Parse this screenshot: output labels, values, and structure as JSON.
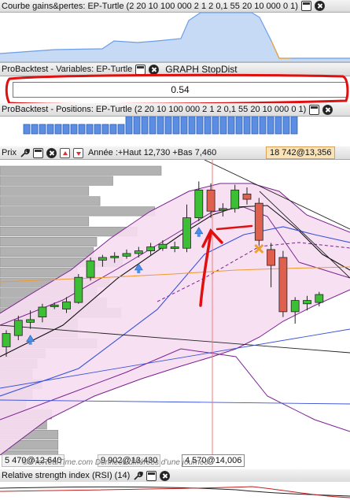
{
  "gains_panel": {
    "title": "Courbe gains&pertes: EP-Turtle (2 20 10 100 000 2 1 2 0,1 55 20 10 000 0 1)"
  },
  "variables_panel": {
    "title": "ProBacktest - Variables: EP-Turtle",
    "variable_name": "GRAPH StopDist",
    "value": "0.54"
  },
  "positions_panel": {
    "title": "ProBacktest - Positions: EP-Turtle (2 20 10 100 000 2 1 2 0,1 55 20 10 000 0 1)"
  },
  "price_panel": {
    "title": "Prix",
    "range_info": "Année :+Haut 12,730 +Bas 7,460",
    "last_tag": "18 742@13,356"
  },
  "bottom_labels": {
    "left": "5 470@12,640",
    "middle": "9 902@13,430",
    "cursor": "4 570@14,006"
  },
  "watermark": "© ProRealTime.com Données différées d'une journée",
  "rsi_panel": {
    "title": "Relative strength index (RSI) (14)"
  },
  "chart_data": {
    "type": "candlestick",
    "candles": [
      {
        "o": 12.25,
        "h": 12.5,
        "l": 12.1,
        "c": 12.45,
        "dir": "up"
      },
      {
        "o": 12.42,
        "h": 12.72,
        "l": 12.35,
        "c": 12.65,
        "dir": "up"
      },
      {
        "o": 12.62,
        "h": 12.8,
        "l": 12.52,
        "c": 12.66,
        "dir": "up"
      },
      {
        "o": 12.7,
        "h": 12.9,
        "l": 12.62,
        "c": 12.85,
        "dir": "up"
      },
      {
        "o": 12.86,
        "h": 12.92,
        "l": 12.82,
        "c": 12.88,
        "dir": "up"
      },
      {
        "o": 12.82,
        "h": 13.0,
        "l": 12.76,
        "c": 12.93,
        "dir": "up"
      },
      {
        "o": 12.92,
        "h": 13.35,
        "l": 12.9,
        "c": 13.3,
        "dir": "up"
      },
      {
        "o": 13.3,
        "h": 13.6,
        "l": 13.25,
        "c": 13.55,
        "dir": "up"
      },
      {
        "o": 13.56,
        "h": 13.64,
        "l": 13.46,
        "c": 13.6,
        "dir": "up"
      },
      {
        "o": 13.6,
        "h": 13.68,
        "l": 13.52,
        "c": 13.62,
        "dir": "up"
      },
      {
        "o": 13.62,
        "h": 13.72,
        "l": 13.58,
        "c": 13.66,
        "dir": "up"
      },
      {
        "o": 13.66,
        "h": 13.76,
        "l": 13.6,
        "c": 13.7,
        "dir": "up"
      },
      {
        "o": 13.7,
        "h": 13.82,
        "l": 13.64,
        "c": 13.76,
        "dir": "up"
      },
      {
        "o": 13.74,
        "h": 13.86,
        "l": 13.7,
        "c": 13.8,
        "dir": "up"
      },
      {
        "o": 13.76,
        "h": 13.84,
        "l": 13.68,
        "c": 13.74,
        "dir": "up"
      },
      {
        "o": 13.74,
        "h": 14.4,
        "l": 13.68,
        "c": 14.2,
        "dir": "up"
      },
      {
        "o": 14.2,
        "h": 14.75,
        "l": 14.15,
        "c": 14.62,
        "dir": "up"
      },
      {
        "o": 14.62,
        "h": 14.72,
        "l": 14.2,
        "c": 14.3,
        "dir": "down"
      },
      {
        "o": 14.32,
        "h": 14.42,
        "l": 14.22,
        "c": 14.34,
        "dir": "up"
      },
      {
        "o": 14.34,
        "h": 14.7,
        "l": 14.28,
        "c": 14.62,
        "dir": "up"
      },
      {
        "o": 14.56,
        "h": 14.66,
        "l": 14.4,
        "c": 14.48,
        "dir": "down"
      },
      {
        "o": 14.42,
        "h": 14.5,
        "l": 13.78,
        "c": 13.86,
        "dir": "down"
      },
      {
        "o": 13.72,
        "h": 13.82,
        "l": 13.15,
        "c": 13.48,
        "dir": "down"
      },
      {
        "o": 13.6,
        "h": 13.7,
        "l": 12.7,
        "c": 12.78,
        "dir": "down"
      },
      {
        "o": 12.78,
        "h": 13.0,
        "l": 12.6,
        "c": 12.95,
        "dir": "up"
      },
      {
        "o": 12.9,
        "h": 13.02,
        "l": 12.8,
        "c": 12.95,
        "dir": "up"
      },
      {
        "o": 12.92,
        "h": 13.08,
        "l": 12.86,
        "c": 13.04,
        "dir": "up"
      }
    ],
    "buy_markers": [
      2,
      11,
      16
    ],
    "sell_marker": 21,
    "volume_profile": [
      1.0,
      0.7,
      0.55,
      0.62,
      0.96,
      0.55,
      0.85,
      0.6,
      0.58,
      0.76,
      0.48,
      0.68,
      0.6,
      0.66,
      0.75,
      0.48,
      0.48,
      0.6,
      0.28,
      0.23,
      0.2,
      0.26,
      0.2,
      0.16,
      0.32,
      0.29,
      0.36,
      0.36,
      0.36
    ],
    "colors": {
      "up": "#3cbf34",
      "down": "#e06050",
      "band_fill": "#f7ddf2",
      "band_line": "#7a2090",
      "ma_black": "#111111",
      "ma_blue": "#3a52d8",
      "ma_orange": "#f09a30",
      "cursor": "#ef7b7b",
      "annotation": "#e01010"
    }
  }
}
